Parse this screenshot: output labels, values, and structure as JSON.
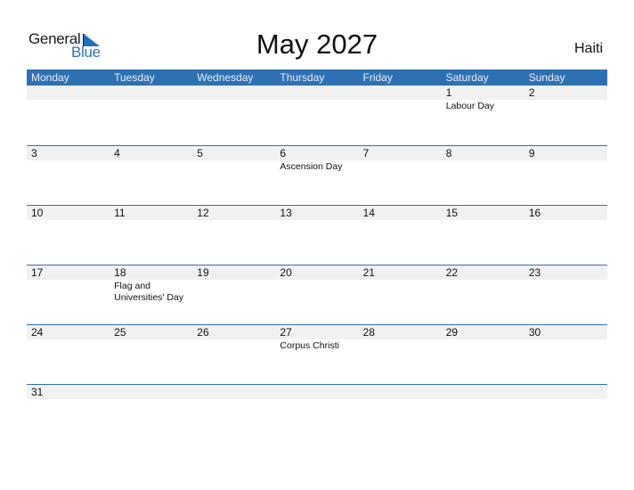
{
  "brand": {
    "line1": "General",
    "line2": "Blue",
    "logo_icon": "blue-triangle-flag"
  },
  "title": "May 2027",
  "country": "Haiti",
  "colors": {
    "header_bg": "#2e71b3",
    "row_strip": "#f1f1f1",
    "brand_blue": "#1e6fbf"
  },
  "weekdays": [
    "Monday",
    "Tuesday",
    "Wednesday",
    "Thursday",
    "Friday",
    "Saturday",
    "Sunday"
  ],
  "weeks": [
    [
      {
        "day": "",
        "event": ""
      },
      {
        "day": "",
        "event": ""
      },
      {
        "day": "",
        "event": ""
      },
      {
        "day": "",
        "event": ""
      },
      {
        "day": "",
        "event": ""
      },
      {
        "day": "1",
        "event": "Labour Day"
      },
      {
        "day": "2",
        "event": ""
      }
    ],
    [
      {
        "day": "3",
        "event": ""
      },
      {
        "day": "4",
        "event": ""
      },
      {
        "day": "5",
        "event": ""
      },
      {
        "day": "6",
        "event": "Ascension Day"
      },
      {
        "day": "7",
        "event": ""
      },
      {
        "day": "8",
        "event": ""
      },
      {
        "day": "9",
        "event": ""
      }
    ],
    [
      {
        "day": "10",
        "event": ""
      },
      {
        "day": "11",
        "event": ""
      },
      {
        "day": "12",
        "event": ""
      },
      {
        "day": "13",
        "event": ""
      },
      {
        "day": "14",
        "event": ""
      },
      {
        "day": "15",
        "event": ""
      },
      {
        "day": "16",
        "event": ""
      }
    ],
    [
      {
        "day": "17",
        "event": ""
      },
      {
        "day": "18",
        "event": "Flag and Universities' Day"
      },
      {
        "day": "19",
        "event": ""
      },
      {
        "day": "20",
        "event": ""
      },
      {
        "day": "21",
        "event": ""
      },
      {
        "day": "22",
        "event": ""
      },
      {
        "day": "23",
        "event": ""
      }
    ],
    [
      {
        "day": "24",
        "event": ""
      },
      {
        "day": "25",
        "event": ""
      },
      {
        "day": "26",
        "event": ""
      },
      {
        "day": "27",
        "event": "Corpus Christi"
      },
      {
        "day": "28",
        "event": ""
      },
      {
        "day": "29",
        "event": ""
      },
      {
        "day": "30",
        "event": ""
      }
    ],
    [
      {
        "day": "31",
        "event": ""
      }
    ]
  ]
}
